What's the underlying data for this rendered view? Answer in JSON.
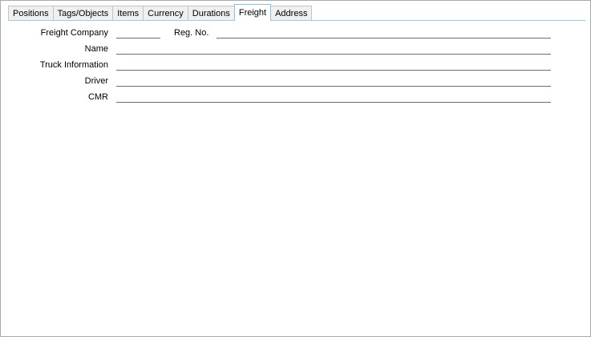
{
  "tabs": [
    {
      "label": "Positions"
    },
    {
      "label": "Tags/Objects"
    },
    {
      "label": "Items"
    },
    {
      "label": "Currency"
    },
    {
      "label": "Durations"
    },
    {
      "label": "Freight",
      "active": true
    },
    {
      "label": "Address"
    }
  ],
  "form": {
    "freight_company": {
      "label": "Freight Company",
      "value": ""
    },
    "reg_no": {
      "label": "Reg. No.",
      "value": ""
    },
    "name": {
      "label": "Name",
      "value": ""
    },
    "truck_information": {
      "label": "Truck Information",
      "value": ""
    },
    "driver": {
      "label": "Driver",
      "value": ""
    },
    "cmr": {
      "label": "CMR",
      "value": ""
    }
  },
  "colors": {
    "active_tab_border": "#8ac0e6",
    "tab_background": "#f0f0f0",
    "panel_background": "#ffffff"
  }
}
